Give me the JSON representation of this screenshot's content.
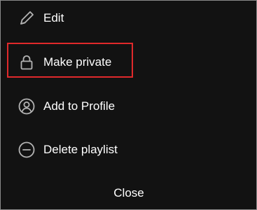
{
  "menu": {
    "items": [
      {
        "label": "Edit",
        "icon": "pencil-icon"
      },
      {
        "label": "Make private",
        "icon": "lock-icon"
      },
      {
        "label": "Add to Profile",
        "icon": "profile-icon"
      },
      {
        "label": "Delete playlist",
        "icon": "minus-circle-icon"
      }
    ],
    "close_label": "Close"
  },
  "colors": {
    "background": "#121212",
    "text": "#ffffff",
    "icon": "#b3b3b3",
    "highlight": "#e0292b"
  }
}
